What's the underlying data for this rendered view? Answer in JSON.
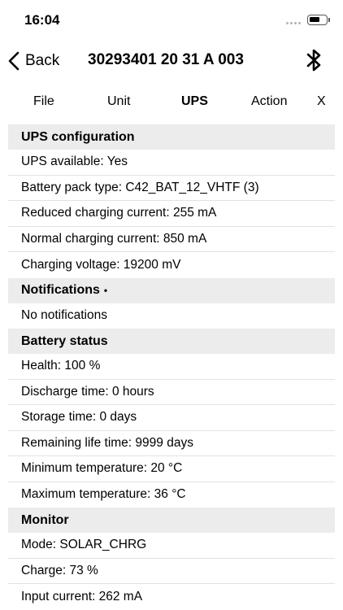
{
  "status_bar": {
    "time": "16:04",
    "battery_icon": "battery-icon",
    "signal_icon": "signal-dots-icon"
  },
  "nav": {
    "back_label": "Back",
    "title": "30293401 20 31 A 003",
    "back_icon": "chevron-left-icon",
    "action_icon": "bluetooth-icon"
  },
  "tabs": [
    {
      "label": "File",
      "active": false
    },
    {
      "label": "Unit",
      "active": false
    },
    {
      "label": "UPS",
      "active": true
    },
    {
      "label": "Action",
      "active": false
    },
    {
      "label": "X",
      "active": false
    }
  ],
  "sections": {
    "ups_config": {
      "title": "UPS configuration",
      "rows": [
        "UPS available: Yes",
        "Battery pack type: C42_BAT_12_VHTF (3)",
        "Reduced charging current: 255 mA",
        "Normal charging current: 850 mA",
        "Charging voltage: 19200 mV"
      ]
    },
    "notifications": {
      "title": "Notifications",
      "indicator": "•",
      "rows": [
        "No notifications"
      ]
    },
    "battery_status": {
      "title": "Battery status",
      "rows": [
        "Health: 100 %",
        "Discharge time: 0 hours",
        "Storage time: 0 days",
        "Remaining life time: 9999 days",
        "Minimum temperature: 20 °C",
        "Maximum temperature: 36 °C"
      ]
    },
    "monitor": {
      "title": "Monitor",
      "rows": [
        "Mode: SOLAR_CHRG",
        "Charge: 73 %",
        "Input current: 262 mA"
      ]
    }
  },
  "colors": {
    "section_background": "#ececec",
    "separator": "#e2e2e2",
    "text": "#000000"
  }
}
